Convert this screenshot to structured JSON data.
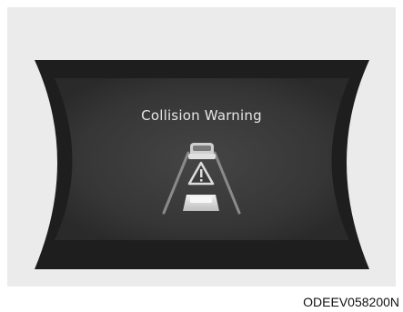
{
  "cluster": {
    "warning_message": "Collision Warning",
    "icon": "forward-collision-warning-icon"
  },
  "figure": {
    "reference_code": "ODEEV058200N"
  },
  "colors": {
    "background_panel": "#ebebeb",
    "display_outer": "#1e1e1e",
    "display_inner": "#3c3c3c",
    "text": "#e6e6e6"
  }
}
